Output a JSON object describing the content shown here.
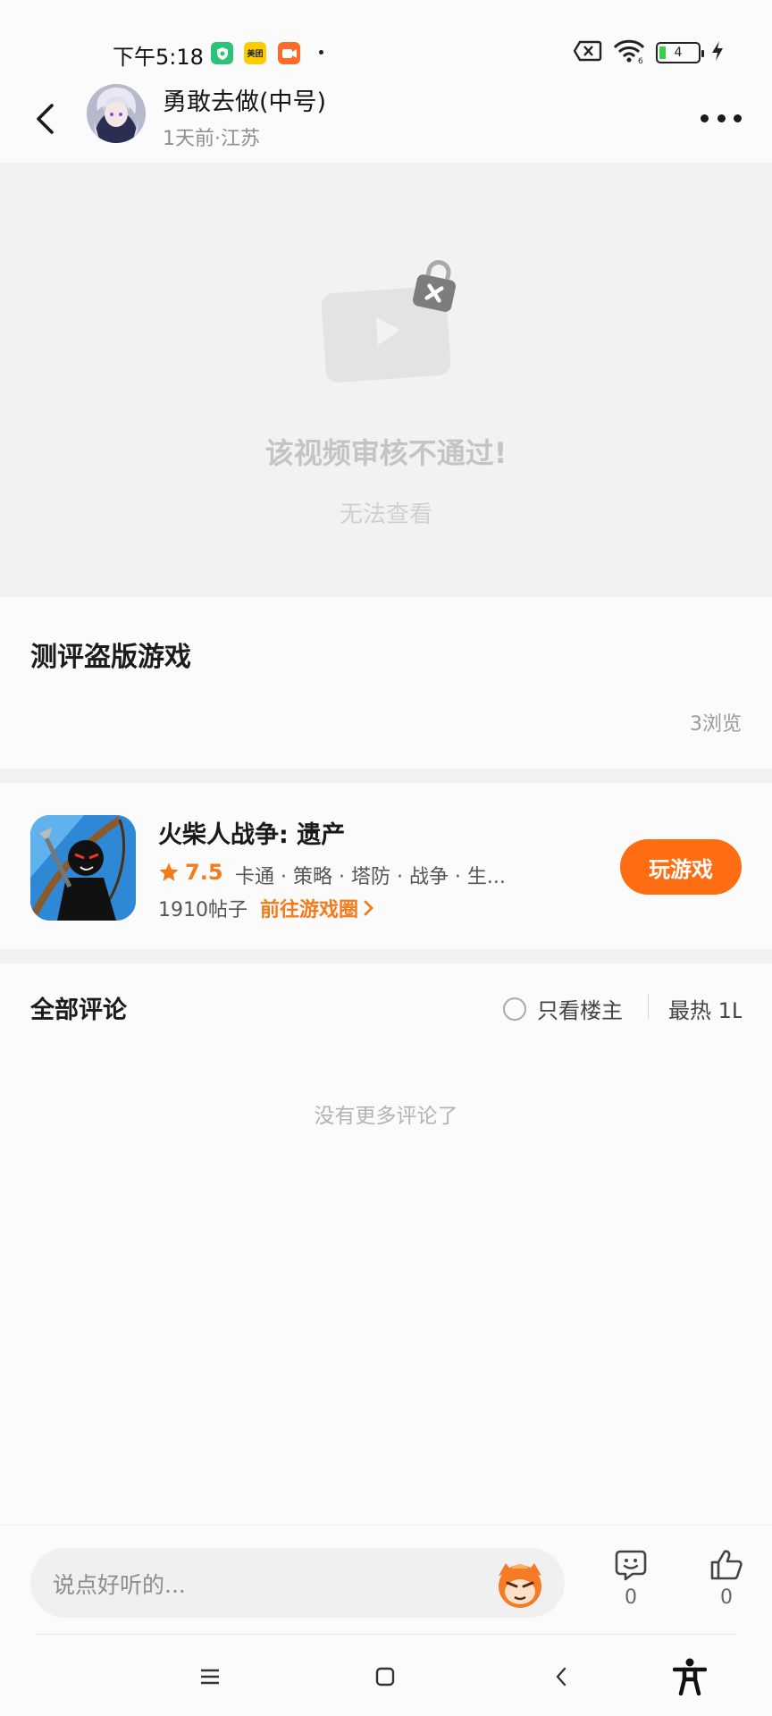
{
  "status_bar": {
    "time": "下午5:18",
    "app_icons": [
      {
        "icon": "shield-app-icon",
        "label": "",
        "color": "#2bc37a"
      },
      {
        "icon": "meituan-app-icon",
        "label": "美团",
        "color": "#ffcc00"
      },
      {
        "icon": "video-app-icon",
        "label": "",
        "color": "#ff6a2a"
      }
    ],
    "battery": "4",
    "signal_icon": "no-sim-icon",
    "wifi_icon": "wifi-6-icon",
    "charging_icon": "charging-icon"
  },
  "header": {
    "back_icon": "chevron-left-icon",
    "author_name": "勇敢去做(中号)",
    "meta": "1天前·江苏",
    "more_icon": "more-dots-icon"
  },
  "video": {
    "title": "该视频审核不通过!",
    "subtitle": "无法查看",
    "icon": "locked-video-icon"
  },
  "post": {
    "title": "测评盗版游戏",
    "views": "3浏览"
  },
  "game": {
    "name": "火柴人战争: 遗产",
    "rating": "7.5",
    "tags": "卡通 · 策略 · 塔防 · 战争 · 生...",
    "posts": "1910帖子",
    "circle_link": "前往游戏圈",
    "play_button": "玩游戏",
    "accent_color": "#ff6d12"
  },
  "comments": {
    "title": "全部评论",
    "only_op": "只看楼主",
    "sort": "最热 1L",
    "empty_text": "没有更多评论了"
  },
  "bottom_bar": {
    "input_placeholder": "说点好听的...",
    "emoji_count": "0",
    "like_count": "0"
  },
  "system_nav": {
    "menu_icon": "menu-icon",
    "home_icon": "home-icon",
    "back_icon": "back-icon",
    "accessibility_icon": "accessibility-icon"
  }
}
